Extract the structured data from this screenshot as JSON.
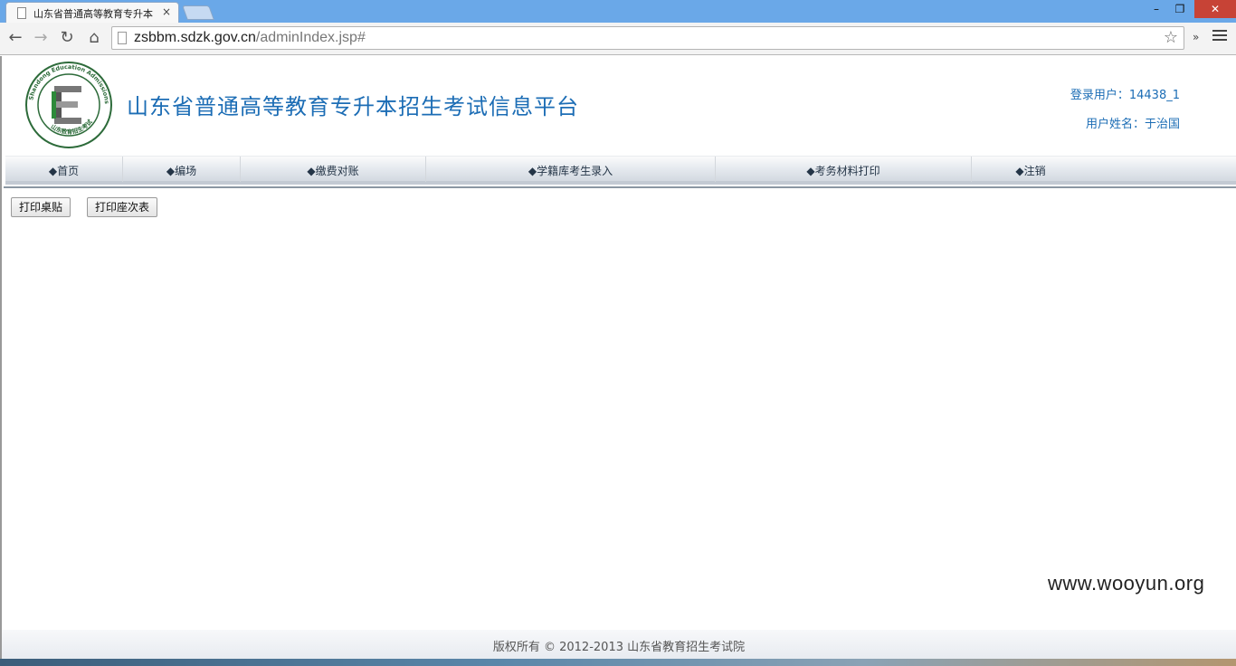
{
  "browser": {
    "tab_title": "山东省普通高等教育专升本",
    "tab_close": "×",
    "url_host": "zsbbm.sdzk.gov.cn",
    "url_path": "/adminIndex.jsp#",
    "window_controls": {
      "minimize": "–",
      "restore": "❐",
      "close": "✕"
    },
    "nav": {
      "back": "←",
      "forward": "→",
      "reload": "↻",
      "home": "⌂",
      "star": "☆",
      "extensions": "»"
    }
  },
  "header": {
    "site_title": "山东省普通高等教育专升本招生考试信息平台",
    "login_user": "登录用户：14438_1",
    "user_name": "用户姓名：于治国"
  },
  "navbar": {
    "items": [
      {
        "label": "◆首页"
      },
      {
        "label": "◆编场"
      },
      {
        "label": "◆缴费对账"
      },
      {
        "label": "◆学籍库考生录入"
      },
      {
        "label": "◆考务材料打印"
      },
      {
        "label": "◆注销"
      }
    ]
  },
  "actions": {
    "print_desk_label": "打印桌贴",
    "print_seating_label": "打印座次表"
  },
  "footer": {
    "copyright": "版权所有 © 2012-2013 山东省教育招生考试院"
  },
  "watermark": "www.wooyun.org",
  "colors": {
    "title_blue": "#1c6db5",
    "logo_green": "#2d6b3a",
    "chrome_blue": "#6aa8e8"
  }
}
